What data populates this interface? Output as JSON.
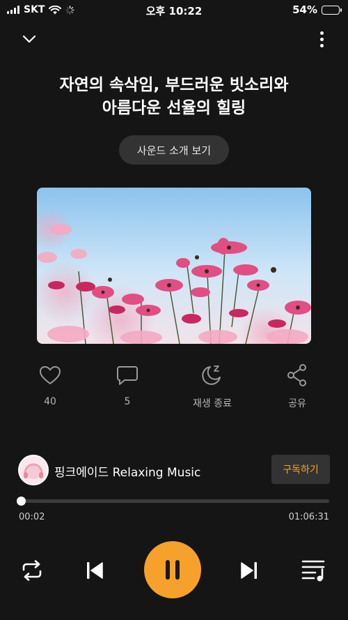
{
  "status": {
    "carrier": "SKT",
    "time": "오후 10:22",
    "battery": "54%",
    "battery_level": 0.54
  },
  "header": {
    "back_icon": "chevron-down-icon",
    "menu_icon": "more-vertical-icon"
  },
  "track": {
    "title_line1": "자연의 속삭임, 부드러운 빗소리와",
    "title_line2": "아름다운 선율의 힐링",
    "intro_button": "사운드 소개 보기",
    "artwork": "pink-cosmos-flowers-sky"
  },
  "actions": {
    "like_count": "40",
    "comment_count": "5",
    "sleep_timer": "재생 종료",
    "share": "공유"
  },
  "channel": {
    "name": "핑크에이드 Relaxing Music",
    "subscribe": "구독하기"
  },
  "playback": {
    "current": "00:02",
    "duration": "01:06:31",
    "progress": 0.0005
  },
  "colors": {
    "background": "#151515",
    "accent": "#f5a12b",
    "subscribe_text": "#f5a623"
  },
  "controls": {
    "repeat_icon": "repeat-icon",
    "prev_icon": "skip-previous-icon",
    "play_state_icon": "pause-icon",
    "next_icon": "skip-next-icon",
    "playlist_icon": "playlist-icon"
  }
}
